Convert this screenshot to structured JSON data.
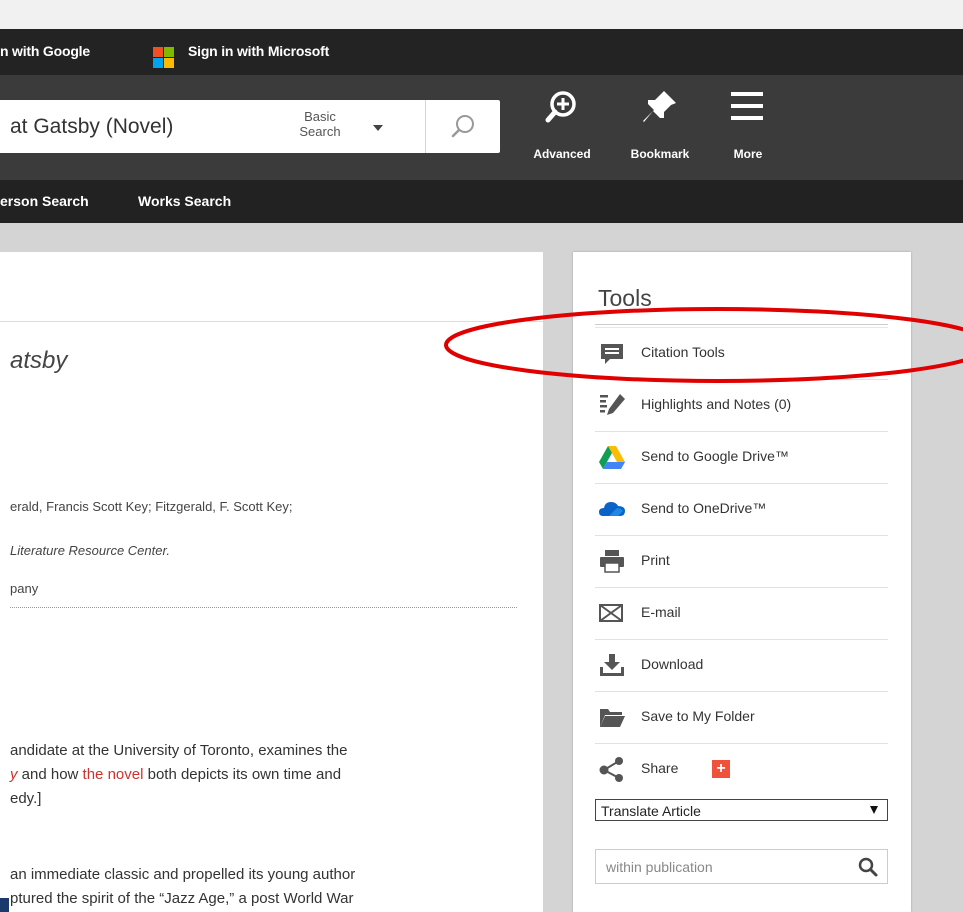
{
  "signin": {
    "google_label": "n with Google",
    "microsoft_label": "Sign in with Microsoft",
    "microsoft_colors": [
      "#f25022",
      "#7fba00",
      "#00a4ef",
      "#ffb900"
    ]
  },
  "search": {
    "query": "at Gatsby (Novel)",
    "mode_line1": "Basic",
    "mode_line2": "Search"
  },
  "toolbar": {
    "advanced_label": "Advanced",
    "bookmark_label": "Bookmark",
    "more_label": "More"
  },
  "nav": {
    "person_search": "erson Search",
    "works_search": "Works Search"
  },
  "article": {
    "title": "atsby",
    "author_line": "erald, Francis Scott Key; Fitzgerald, F. Scott Key;",
    "source_line": "Literature Resource Center.",
    "publisher_line": "pany",
    "para1_line1": "andidate at the University of Toronto, examines the",
    "para1_line2_a": "y",
    "para1_line2_b": " and how ",
    "para1_line2_c": "the novel",
    "para1_line2_d": " both depicts its own time and",
    "para1_line3": "edy.]",
    "para2_line1": "an immediate classic and propelled its young author",
    "para2_line2": "ptured the spirit of the “Jazz Age,” a post World War"
  },
  "tools": {
    "heading": "Tools",
    "items": [
      {
        "label": "Citation Tools",
        "icon": "citation-icon"
      },
      {
        "label": "Highlights and Notes (0)",
        "icon": "highlight-pen-icon"
      },
      {
        "label": "Send to Google Drive™",
        "icon": "google-drive-icon"
      },
      {
        "label": "Send to OneDrive™",
        "icon": "onedrive-icon"
      },
      {
        "label": "Print",
        "icon": "printer-icon"
      },
      {
        "label": "E-mail",
        "icon": "email-icon"
      },
      {
        "label": "Download",
        "icon": "download-icon"
      },
      {
        "label": "Save to My Folder",
        "icon": "folder-icon"
      },
      {
        "label": "Share",
        "icon": "share-icon"
      }
    ],
    "share_plus": "+",
    "translate_label": "Translate Article",
    "within_placeholder": "within publication"
  },
  "colors": {
    "annotation_red": "#e00000",
    "link_red": "#d0312d",
    "plus_badge": "#f0513a"
  }
}
